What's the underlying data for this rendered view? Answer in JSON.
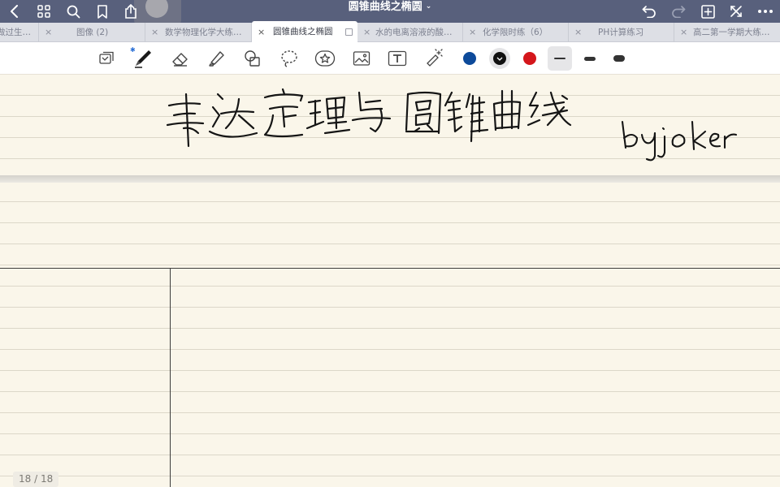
{
  "window": {
    "title": "圆锥曲线之椭圆",
    "title_chevron": "⌄"
  },
  "titlebar_icons": {
    "left": [
      "back-icon",
      "grid-icon",
      "search-icon",
      "bookmark-icon",
      "share-icon"
    ],
    "right": [
      "undo-icon",
      "redo-icon",
      "add-page-icon",
      "close-fullscreen-icon",
      "more-icon"
    ]
  },
  "tabs": [
    {
      "label": "做过生…",
      "active": false
    },
    {
      "label": "图像 (2)",
      "active": false
    },
    {
      "label": "数学物理化学大练…",
      "active": false
    },
    {
      "label": "圆锥曲线之椭圆",
      "active": true
    },
    {
      "label": "水的电离溶液的酸…",
      "active": false
    },
    {
      "label": "化学限时练（6）",
      "active": false
    },
    {
      "label": "PH计算练习",
      "active": false
    },
    {
      "label": "高二第一学期大练…",
      "active": false
    }
  ],
  "tab_close_glyph": "×",
  "toolbar": {
    "tools": [
      "read-mode-icon",
      "pen-icon",
      "eraser-icon",
      "highlighter-icon",
      "shapes-icon",
      "lasso-icon",
      "sticker-icon",
      "image-icon",
      "text-icon",
      "laser-pointer-icon"
    ],
    "bluetooth_glyph": "✱",
    "colors": [
      "#0d4a9a",
      "#111111",
      "#d4161b"
    ],
    "selected_color": "#111111",
    "strokes": [
      "thin",
      "medium",
      "thick"
    ],
    "selected_stroke": "thin"
  },
  "notes": {
    "handwritten_title": "韦达定理与圆锥曲线",
    "handwritten_author": "by joker"
  },
  "page_indicator": "18 / 18"
}
